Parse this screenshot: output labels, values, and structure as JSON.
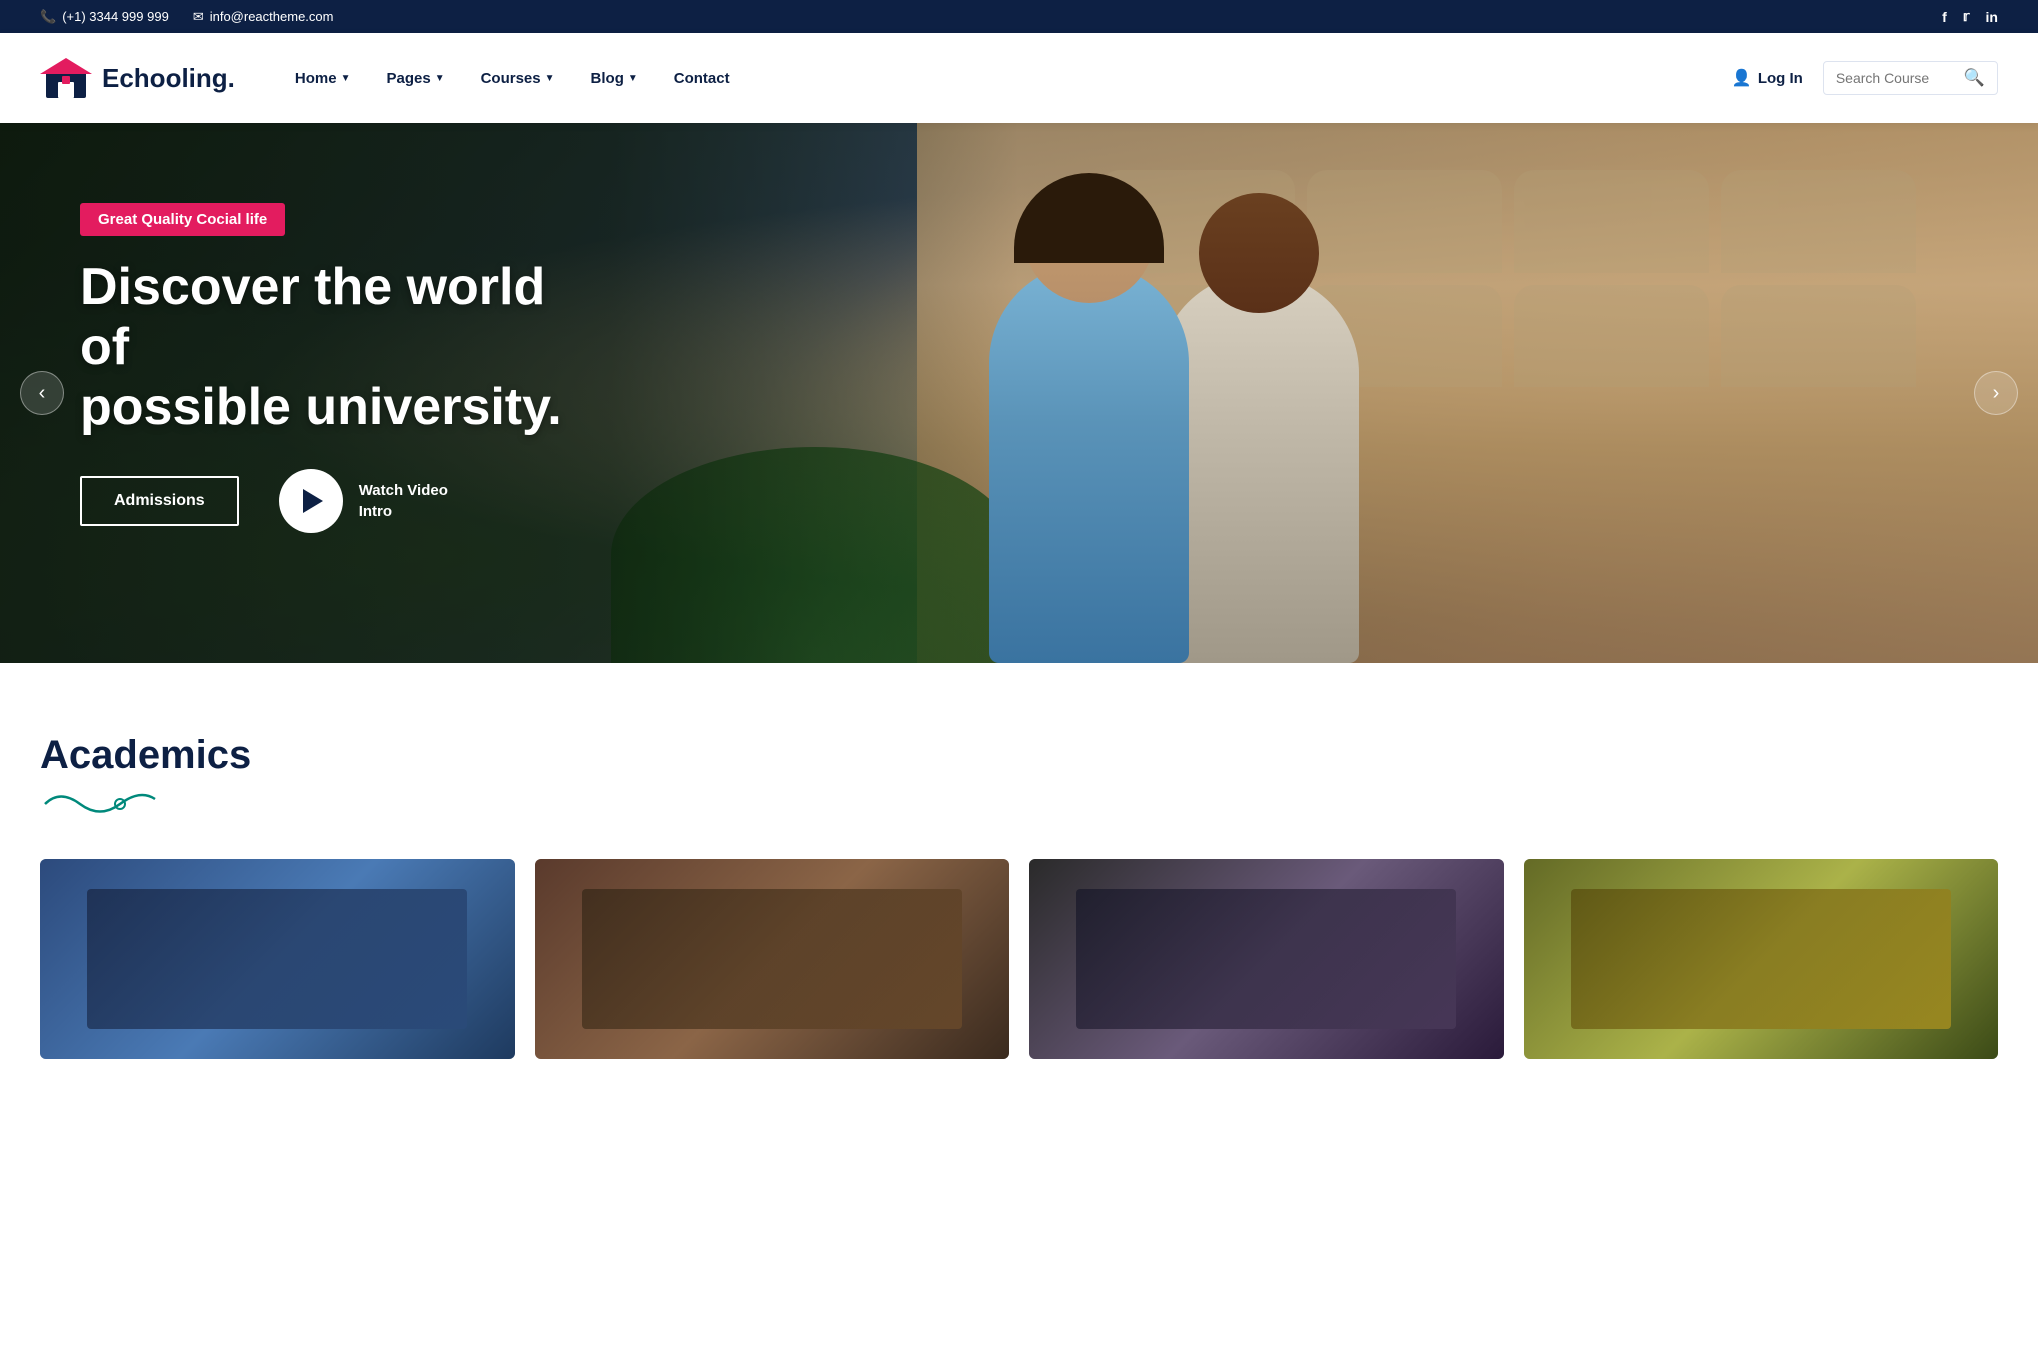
{
  "topbar": {
    "phone": "(+1) 3344 999 999",
    "email": "info@reactheme.com",
    "social": [
      {
        "name": "Facebook",
        "icon": "f"
      },
      {
        "name": "Twitter",
        "icon": "t"
      },
      {
        "name": "LinkedIn",
        "icon": "in"
      }
    ]
  },
  "logo": {
    "text": "Echooling.",
    "alt": "Echooling logo"
  },
  "nav": {
    "links": [
      {
        "label": "Home",
        "has_dropdown": true
      },
      {
        "label": "Pages",
        "has_dropdown": true
      },
      {
        "label": "Courses",
        "has_dropdown": true
      },
      {
        "label": "Blog",
        "has_dropdown": true
      },
      {
        "label": "Contact",
        "has_dropdown": false
      }
    ],
    "login_label": "Log In",
    "search_placeholder": "Search Course"
  },
  "hero": {
    "badge_text": "Great Quality Cocial life",
    "title_line1": "Discover the world of",
    "title_line2": "possible university.",
    "admissions_btn": "Admissions",
    "video_label_line1": "Watch Video",
    "video_label_line2": "Intro"
  },
  "academics": {
    "section_title": "Academics",
    "cards": [
      {
        "id": 1,
        "alt": "Academic card 1"
      },
      {
        "id": 2,
        "alt": "Academic card 2"
      },
      {
        "id": 3,
        "alt": "Academic card 3"
      },
      {
        "id": 4,
        "alt": "Academic card 4"
      }
    ]
  },
  "colors": {
    "brand_dark": "#0d2044",
    "brand_red": "#e31c5f",
    "brand_teal": "#00897b",
    "white": "#ffffff"
  }
}
